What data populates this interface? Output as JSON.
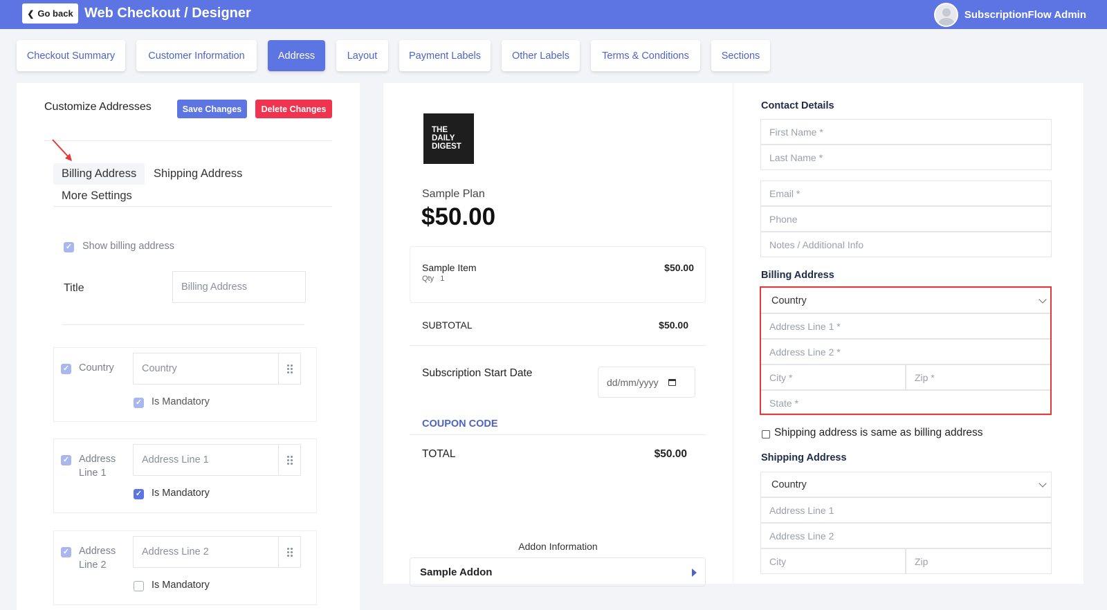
{
  "header": {
    "go_back": "Go back",
    "title": "Web Checkout / Designer",
    "user_name": "SubscriptionFlow Admin"
  },
  "tabs": [
    {
      "label": "Checkout Summary",
      "active": false
    },
    {
      "label": "Customer Information",
      "active": false
    },
    {
      "label": "Address",
      "active": true
    },
    {
      "label": "Layout",
      "active": false
    },
    {
      "label": "Payment Labels",
      "active": false
    },
    {
      "label": "Other Labels",
      "active": false
    },
    {
      "label": "Terms & Conditions",
      "active": false
    },
    {
      "label": "Sections",
      "active": false
    }
  ],
  "left": {
    "title": "Customize Addresses",
    "save_label": "Save Changes",
    "delete_label": "Delete Changes",
    "subtabs": {
      "billing": "Billing Address",
      "shipping": "Shipping Address",
      "more": "More Settings"
    },
    "show_billing": {
      "label": "Show billing address",
      "checked": true
    },
    "title_field": {
      "label": "Title",
      "value": "Billing Address"
    },
    "fields": [
      {
        "label": "Country",
        "value": "Country",
        "enabled": true,
        "mandatory_label": "Is Mandatory",
        "mandatory": true
      },
      {
        "label": "Address Line 1",
        "value": "Address Line 1",
        "enabled": true,
        "mandatory_label": "Is Mandatory",
        "mandatory": true
      },
      {
        "label": "Address Line 2",
        "value": "Address Line 2",
        "enabled": true,
        "mandatory_label": "Is Mandatory",
        "mandatory": false
      }
    ]
  },
  "preview": {
    "logo_lines": [
      "THE",
      "DAILY",
      "DIGEST"
    ],
    "plan_name": "Sample Plan",
    "plan_price": "$50.00",
    "item": {
      "name": "Sample Item",
      "qty_label": "Qty",
      "qty": "1",
      "price": "$50.00"
    },
    "subtotal_label": "SUBTOTAL",
    "subtotal_value": "$50.00",
    "start_date_label": "Subscription Start Date",
    "start_date_placeholder": "dd/mm/yyyy",
    "coupon_label": "COUPON CODE",
    "total_label": "TOTAL",
    "total_value": "$50.00",
    "addon_title": "Addon Information",
    "addon_name": "Sample Addon"
  },
  "form": {
    "contact_title": "Contact Details",
    "first_name": "First Name *",
    "last_name": "Last Name *",
    "email": "Email *",
    "phone": "Phone",
    "notes": "Notes / Additional Info",
    "billing_title": "Billing Address",
    "billing": {
      "country": "Country",
      "line1": "Address Line 1 *",
      "line2": "Address Line 2 *",
      "city": "City *",
      "zip": "Zip *",
      "state": "State *"
    },
    "same_as_billing": "Shipping address is same as billing address",
    "shipping_title": "Shipping Address",
    "shipping": {
      "country": "Country",
      "line1": "Address Line 1",
      "line2": "Address Line 2",
      "city": "City",
      "zip": "Zip"
    }
  },
  "colors": {
    "primary": "#5d74e3",
    "danger": "#f0334f",
    "highlight": "#e53935"
  }
}
